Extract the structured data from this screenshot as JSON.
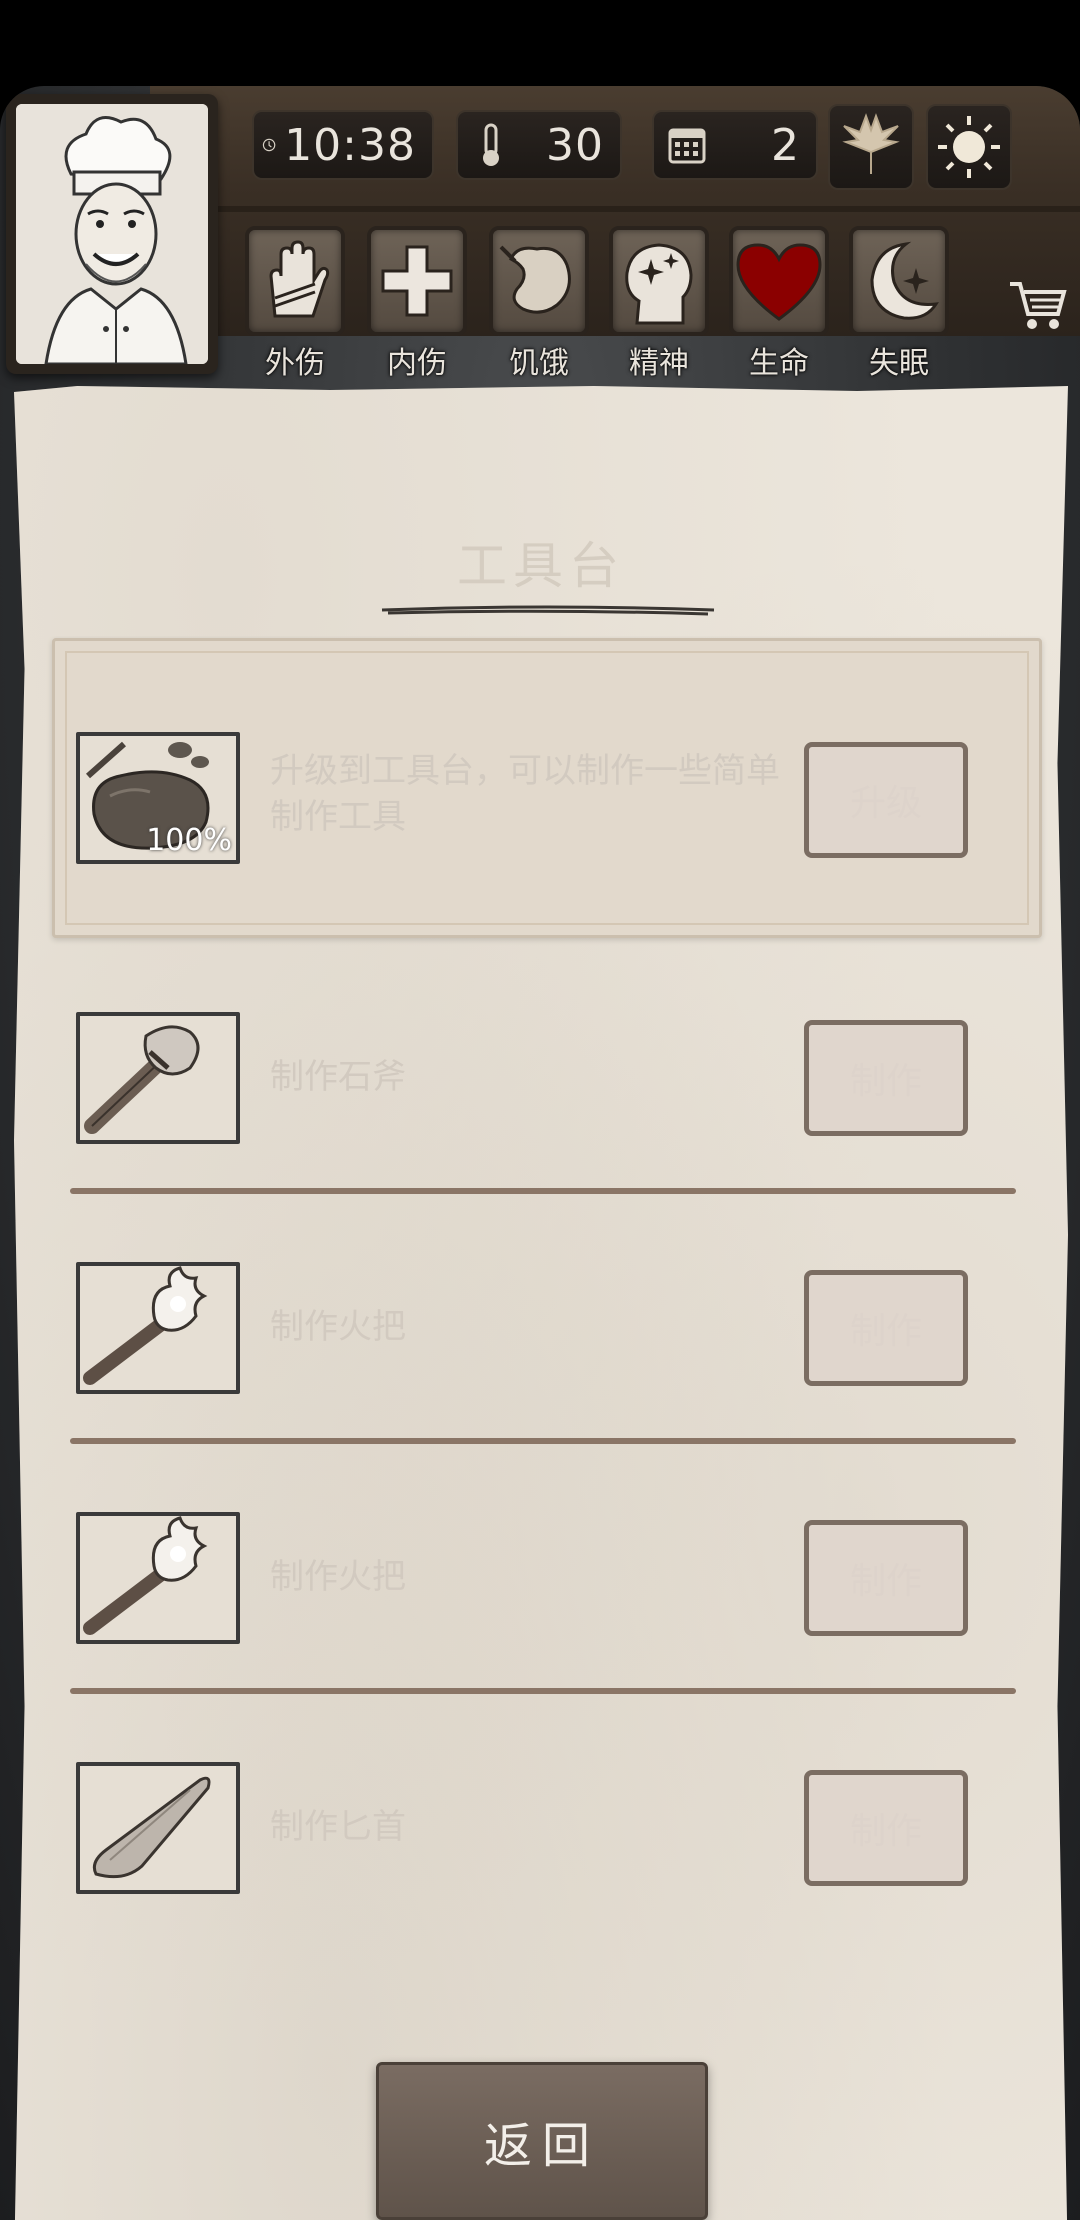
{
  "status": {
    "time": "10:38",
    "temperature": "30",
    "day": "2",
    "icons": [
      "clock-icon",
      "thermometer-icon",
      "calendar-icon",
      "leaf-icon",
      "sun-icon"
    ]
  },
  "conditions": [
    {
      "label": "外伤",
      "icon": "hand-icon"
    },
    {
      "label": "内伤",
      "icon": "cross-icon"
    },
    {
      "label": "饥饿",
      "icon": "stomach-icon"
    },
    {
      "label": "精神",
      "icon": "head-sparkle-icon"
    },
    {
      "label": "生命",
      "icon": "heart-icon"
    },
    {
      "label": "失眠",
      "icon": "moon-star-icon"
    }
  ],
  "panel": {
    "title": "工具台",
    "featured": {
      "description": "升级到工具台，可以制作一些简单制作工具",
      "quantity": "100%",
      "button": "升级"
    },
    "items": [
      {
        "name": "制作石斧",
        "button": "制作",
        "icon": "stone-axe-icon"
      },
      {
        "name": "制作火把",
        "button": "制作",
        "icon": "torch-icon"
      },
      {
        "name": "制作火把",
        "button": "制作",
        "icon": "torch-icon"
      },
      {
        "name": "制作匕首",
        "button": "制作",
        "icon": "stone-dagger-icon"
      }
    ]
  },
  "back_button": "返回",
  "colors": {
    "paper": "#ece6dc",
    "heart": "#8b0000",
    "button_border": "#7b6d62",
    "back_button": "#6b5e55"
  }
}
